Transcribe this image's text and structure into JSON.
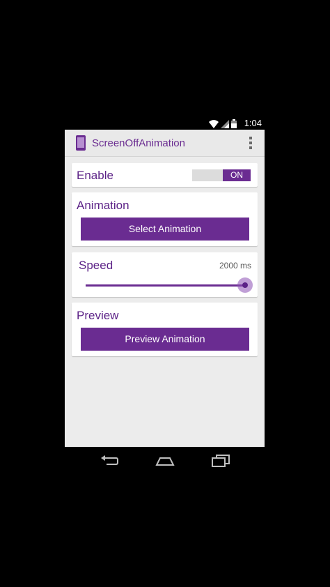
{
  "status_bar": {
    "time": "1:04",
    "icons": [
      "wifi-icon",
      "signal-icon",
      "battery-icon"
    ]
  },
  "action_bar": {
    "title": "ScreenOffAnimation",
    "icon": "phone-icon",
    "menu_icon": "overflow-menu-icon"
  },
  "enable": {
    "label": "Enable",
    "toggle_state": "ON"
  },
  "animation": {
    "label": "Animation",
    "button_label": "Select Animation"
  },
  "speed": {
    "label": "Speed",
    "value_text": "2000 ms",
    "slider_fraction": 1.0
  },
  "preview": {
    "label": "Preview",
    "button_label": "Preview Animation"
  },
  "nav_bar": {
    "buttons": [
      "back-icon",
      "home-icon",
      "recents-icon"
    ]
  },
  "colors": {
    "accent": "#6a2c91",
    "background": "#ececec",
    "card": "#ffffff"
  }
}
